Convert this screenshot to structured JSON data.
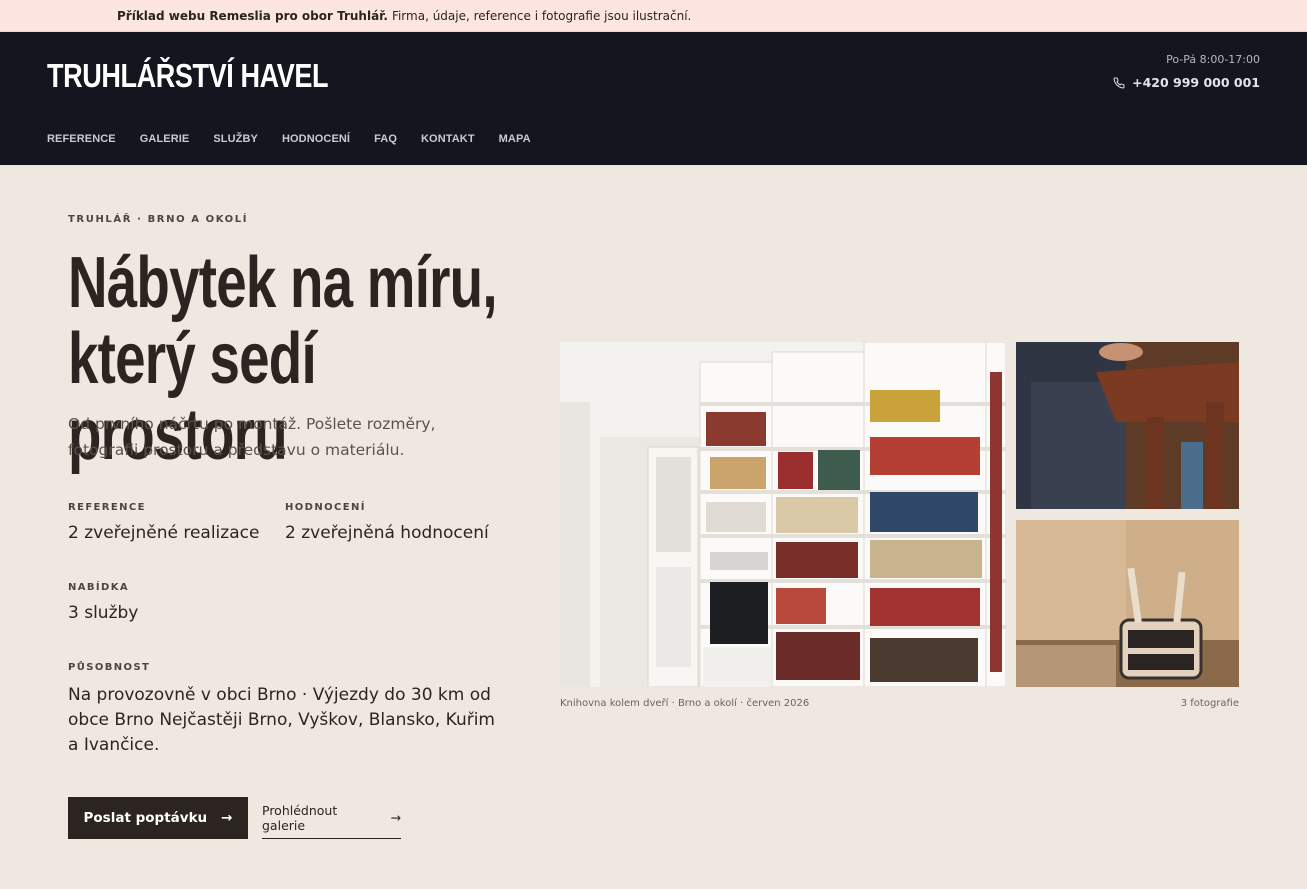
{
  "notice": {
    "bold": "Příklad webu Remeslia pro obor Truhlář.",
    "text": "Firma, údaje, reference i fotografie jsou ilustrační."
  },
  "header": {
    "brand": "TRUHLÁŘSTVÍ HAVEL",
    "hours": "Po-Pá 8:00-17:00",
    "phone": "+420 999 000 001",
    "nav": [
      "REFERENCE",
      "GALERIE",
      "SLUŽBY",
      "HODNOCENÍ",
      "FAQ",
      "KONTAKT",
      "MAPA"
    ]
  },
  "hero": {
    "eyebrow": "TRUHLÁŘ · BRNO A OKOLÍ",
    "title_line1": "Nábytek na míru,",
    "title_line2": "který sedí prostoru",
    "lead": "Od prvního náčrtu po montáž. Pošlete rozměry, fotografii prostoru a představu o materiálu.",
    "stats": {
      "reference_label": "REFERENCE",
      "reference_value": "2 zveřejněné realizace",
      "rating_label": "HODNOCENÍ",
      "rating_value": "2 zveřejněná hodnocení",
      "offer_label": "NABÍDKA",
      "offer_value": "3 služby",
      "area_label": "PŮSOBNOST",
      "area_value": "Na provozovně v obci Brno · Výjezdy do 30 km od obce Brno Nejčastěji Brno, Vyškov, Blansko, Kuřim a Ivančice."
    },
    "primary_button": "Poslat poptávku",
    "secondary_button": "Prohlédnout galerie"
  },
  "gallery": {
    "caption": "Knihovna kolem dveří · Brno a okolí · červen 2026",
    "count": "3 fotografie"
  },
  "colors": {
    "header_bg": "#14161f",
    "page_bg": "#efe8e1",
    "notice_bg": "#fde6e2",
    "button_bg": "#2b2420"
  }
}
